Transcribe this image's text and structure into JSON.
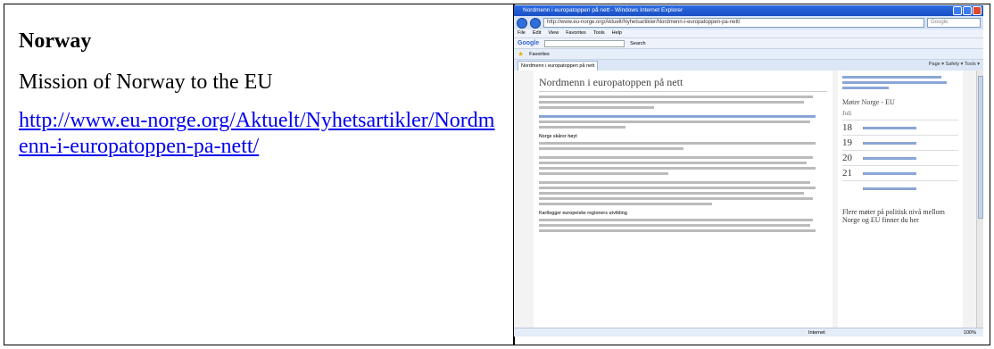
{
  "left": {
    "country": "Norway",
    "organization": "Mission of Norway to the EU",
    "link": "http://www.eu-norge.org/Aktuelt/Nyhetsartikler/Nordmenn-i-europatoppen-pa-nett/"
  },
  "browser": {
    "title": "Nordmenn i europatoppen på nett - Windows Internet Explorer",
    "url": "http://www.eu-norge.org/Aktuelt/Nyhetsartikler/Nordmenn-i-europatoppen-pa-nett/",
    "search_placeholder": "Google",
    "menu": [
      "File",
      "Edit",
      "View",
      "Favorites",
      "Tools",
      "Help"
    ],
    "google_label": "Google",
    "google_search": "Search",
    "favorites": "Favorites",
    "tab_label": "Nordmenn i europatoppen på nett",
    "commands": "Page ▾  Safety ▾  Tools ▾",
    "status_zone": "Internet",
    "status_zoom": "100%"
  },
  "page": {
    "heading": "Nordmenn i europatoppen på nett",
    "subheads": [
      "Norge skårer høyt",
      "Kartlegger europeiske regioners utvikling"
    ],
    "sidebar_title": "Møter Norge - EU",
    "sidebar_month": "Juli",
    "event_days": [
      "18",
      "19",
      "20",
      "21"
    ],
    "sidebar_more": "Flere møter på politisk nivå mellom Norge og EU finner du her"
  }
}
